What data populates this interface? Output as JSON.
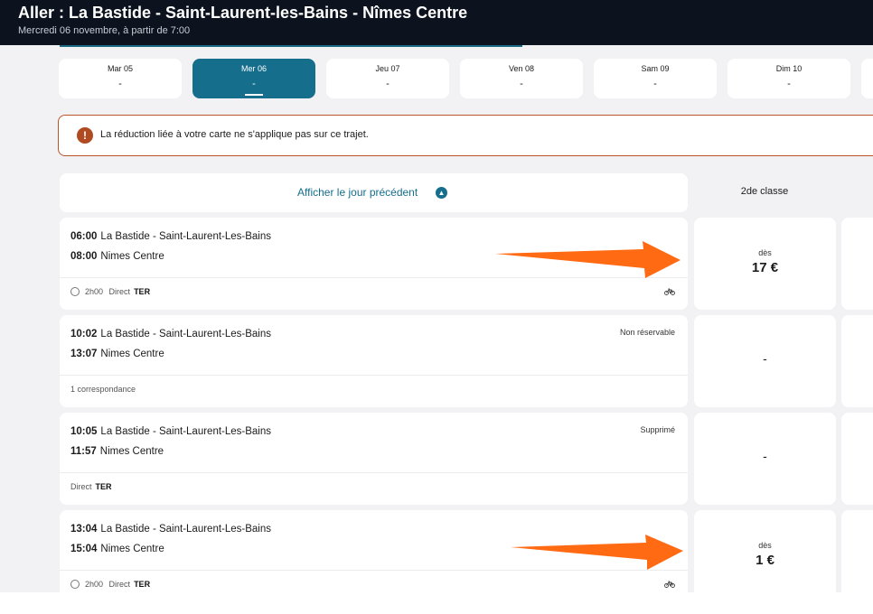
{
  "header": {
    "title": "Aller : La Bastide - Saint-Laurent-les-Bains - Nîmes Centre",
    "subtitle": "Mercredi 06 novembre, à partir de 7:00"
  },
  "date_tabs": [
    {
      "day": "Mar 05",
      "price": "-"
    },
    {
      "day": "Mer 06",
      "price": "-",
      "active": true
    },
    {
      "day": "Jeu 07",
      "price": "-"
    },
    {
      "day": "Ven 08",
      "price": "-"
    },
    {
      "day": "Sam 09",
      "price": "-"
    },
    {
      "day": "Dim 10",
      "price": "-"
    }
  ],
  "alert": {
    "icon": "exclamation-icon",
    "text": "La réduction liée à votre carte ne s'applique pas sur ce trajet."
  },
  "prev_day": {
    "label": "Afficher le jour précédent",
    "icon": "chevron-up-icon"
  },
  "class_header": "2de classe",
  "journeys": [
    {
      "dep_time": "06:00",
      "dep_station": "La Bastide - Saint-Laurent-Les-Bains",
      "arr_time": "08:00",
      "arr_station": "Nimes Centre",
      "duration": "2h00",
      "type": "Direct",
      "train": "TER",
      "status": "",
      "bike": true,
      "price_from": "dès",
      "price": "17 €"
    },
    {
      "dep_time": "10:02",
      "dep_station": "La Bastide - Saint-Laurent-Les-Bains",
      "arr_time": "13:07",
      "arr_station": "Nimes Centre",
      "duration": "",
      "type": "1 correspondance",
      "train": "",
      "status": "Non réservable",
      "bike": false,
      "price_from": "",
      "price": "-"
    },
    {
      "dep_time": "10:05",
      "dep_station": "La Bastide - Saint-Laurent-Les-Bains",
      "arr_time": "11:57",
      "arr_station": "Nimes Centre",
      "duration": "",
      "type": "Direct",
      "train": "TER",
      "status": "Supprimé",
      "bike": false,
      "price_from": "",
      "price": "-"
    },
    {
      "dep_time": "13:04",
      "dep_station": "La Bastide - Saint-Laurent-Les-Bains",
      "arr_time": "15:04",
      "arr_station": "Nimes Centre",
      "duration": "2h00",
      "type": "Direct",
      "train": "TER",
      "status": "",
      "bike": true,
      "price_from": "dès",
      "price": "1 €"
    }
  ],
  "colors": {
    "header_bg": "#0c131f",
    "accent": "#156e8c",
    "alert_border": "#b8532a",
    "annotation_arrow": "#ff6a13"
  }
}
